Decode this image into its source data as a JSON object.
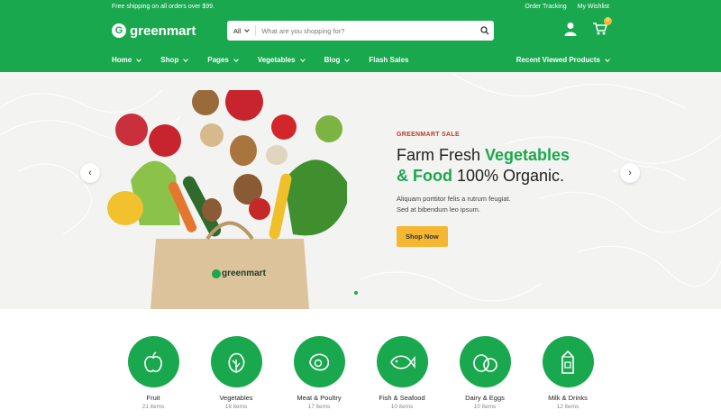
{
  "topbar": {
    "promo": "Free shipping on all orders over $99.",
    "order_tracking": "Order Tracking",
    "wishlist": "My Wishlist"
  },
  "header": {
    "logo_text": "greenmart",
    "search_category": "All",
    "search_placeholder": "What are you shopping for?",
    "cart_count": "0"
  },
  "nav": {
    "items": [
      "Home",
      "Shop",
      "Pages",
      "Vegetables",
      "Blog",
      "Flash Sales"
    ],
    "recent": "Recent Viewed Products"
  },
  "hero": {
    "eyebrow": "GREENMART SALE",
    "headline_1": "Farm Fresh ",
    "headline_2": "Vegetables",
    "headline_3": "& Food",
    "headline_4": " 100% Organic.",
    "desc_1": "Aliquam porttitor felis a rutrum feugiat.",
    "desc_2": "Sed at bibendum leo ipsum.",
    "cta": "Shop Now",
    "bag_brand": "greenmart"
  },
  "categories": [
    {
      "name": "Fruit",
      "count": "21 items"
    },
    {
      "name": "Vegetables",
      "count": "18 items"
    },
    {
      "name": "Meat & Poultry",
      "count": "17 items"
    },
    {
      "name": "Fish & Seafood",
      "count": "10 items"
    },
    {
      "name": "Dairy & Eggs",
      "count": "10 items"
    },
    {
      "name": "Milk & Drinks",
      "count": "12 items"
    }
  ],
  "colors": {
    "brand": "#1aa84f",
    "accent": "#f5b731",
    "eyebrow": "#c0392b"
  }
}
